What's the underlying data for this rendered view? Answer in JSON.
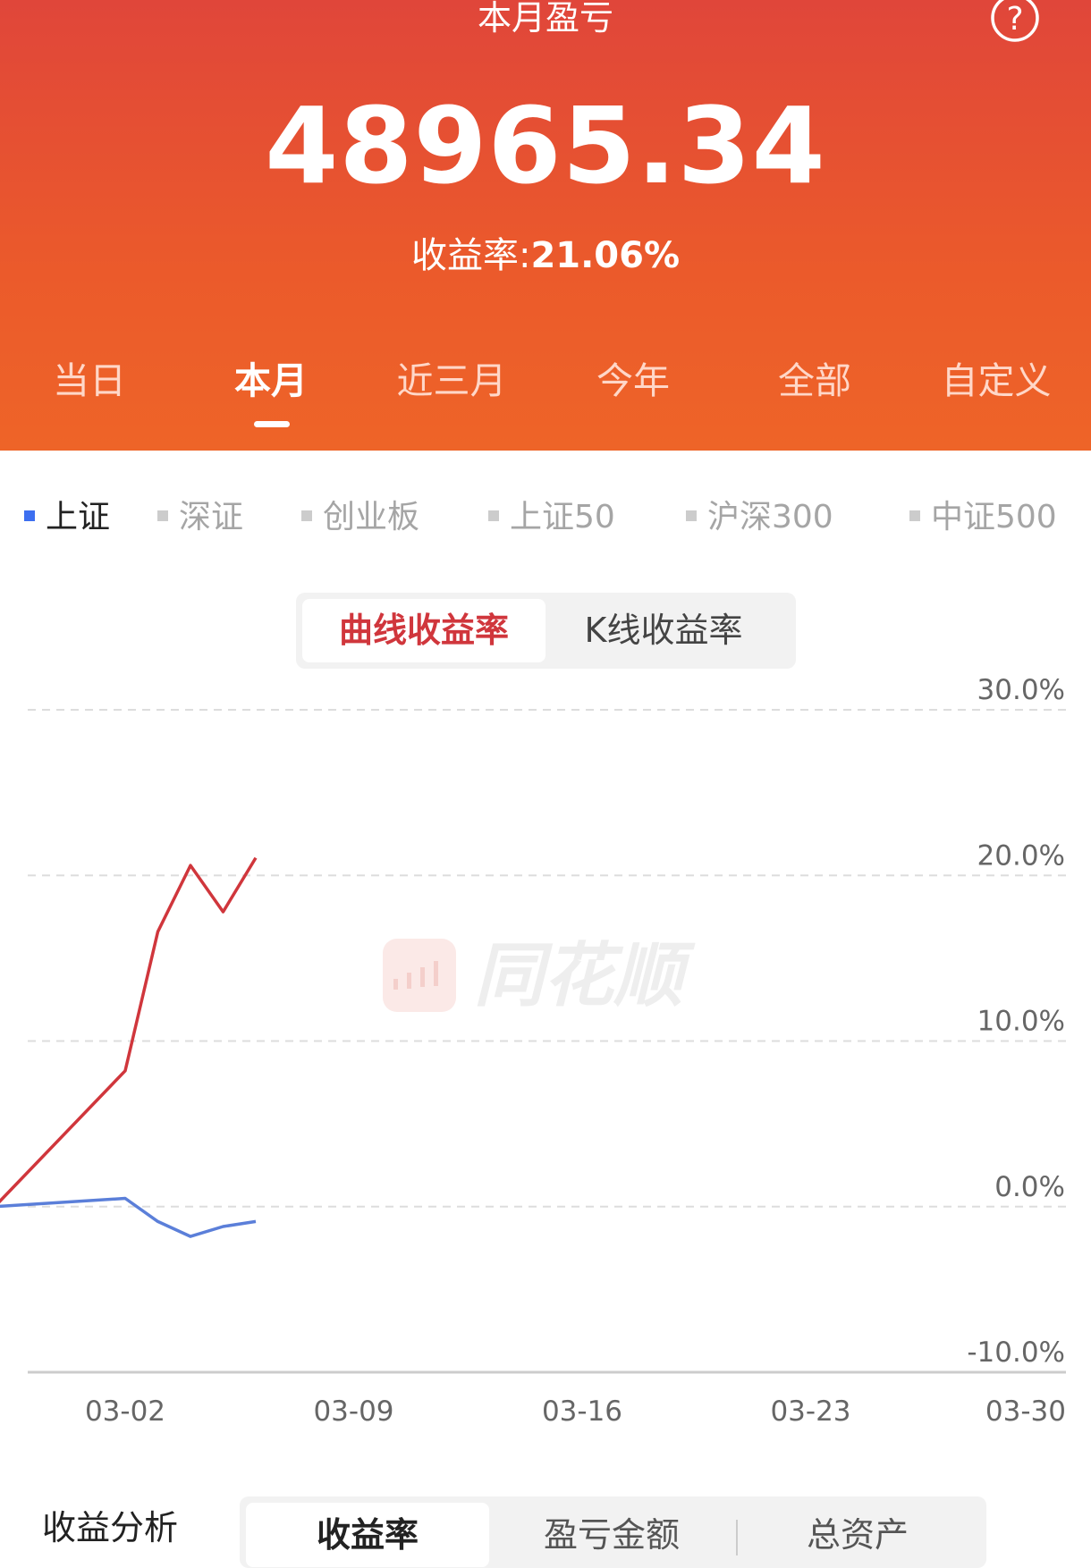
{
  "header": {
    "title": "本月盈亏",
    "amount": "48965.34",
    "rate_label": "收益率:",
    "rate_value": "21.06%",
    "help_icon": "question-circle-icon"
  },
  "period_tabs": [
    {
      "label": "当日",
      "active": false
    },
    {
      "label": "本月",
      "active": true
    },
    {
      "label": "近三月",
      "active": false
    },
    {
      "label": "今年",
      "active": false
    },
    {
      "label": "全部",
      "active": false
    },
    {
      "label": "自定义",
      "active": false
    }
  ],
  "index_tabs": [
    {
      "label": "上证",
      "active": true
    },
    {
      "label": "深证",
      "active": false
    },
    {
      "label": "创业板",
      "active": false
    },
    {
      "label": "上证50",
      "active": false
    },
    {
      "label": "沪深300",
      "active": false
    },
    {
      "label": "中证500",
      "active": false
    }
  ],
  "chart_mode": {
    "active": "曲线收益率",
    "inactive": "K线收益率"
  },
  "watermark": "同花顺",
  "chart_data": {
    "type": "line",
    "y_ticks": [
      "30.0%",
      "20.0%",
      "10.0%",
      "0.0%",
      "-10.0%"
    ],
    "x_ticks": [
      "03-02",
      "03-09",
      "03-16",
      "03-23",
      "03-30"
    ],
    "ylim": [
      -10,
      30
    ],
    "grid": true,
    "series": [
      {
        "color": "#d0363c",
        "points": [
          [
            "02-27",
            0.0
          ],
          [
            "03-02",
            8.2
          ],
          [
            "03-03",
            16.6
          ],
          [
            "03-04",
            20.6
          ],
          [
            "03-05",
            17.8
          ],
          [
            "03-06",
            21.06
          ]
        ]
      },
      {
        "color": "#5b7fd9",
        "points": [
          [
            "02-27",
            0.0
          ],
          [
            "03-02",
            0.5
          ],
          [
            "03-03",
            -0.9
          ],
          [
            "03-04",
            -1.8
          ],
          [
            "03-05",
            -1.2
          ],
          [
            "03-06",
            -0.9
          ]
        ]
      }
    ]
  },
  "analysis": {
    "label": "收益分析",
    "tabs": [
      {
        "label": "收益率",
        "active": true
      },
      {
        "label": "盈亏金额",
        "active": false
      },
      {
        "label": "总资产",
        "active": false
      }
    ]
  }
}
